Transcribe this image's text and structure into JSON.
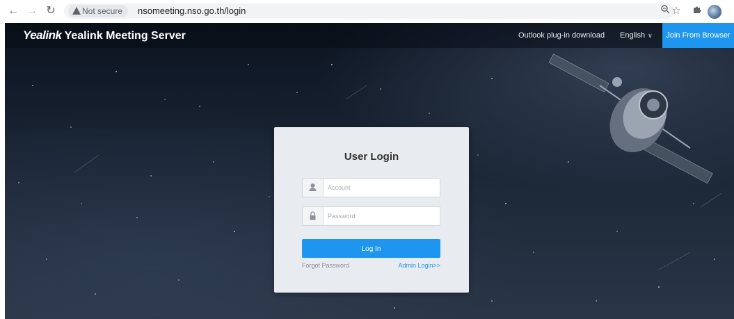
{
  "browser": {
    "security_label": "Not secure",
    "url": "nsomeeting.nso.go.th/login",
    "nav": {
      "back_icon": "back-arrow-icon",
      "forward_icon": "forward-arrow-icon",
      "reload_icon": "reload-icon"
    }
  },
  "header": {
    "logo_brand": "Yealink",
    "logo_product": "Yealink Meeting Server",
    "outlook_link": "Outlook plug-in download",
    "language": "English",
    "join_button": "Join From Browser"
  },
  "login": {
    "title": "User Login",
    "account_placeholder": "Account",
    "password_placeholder": "Password",
    "login_button": "Log In",
    "forgot_link": "Forgot Password",
    "admin_link": "Admin Login>>"
  },
  "colors": {
    "accent": "#1e96f0",
    "panel_bg": "#e8ebef",
    "night_sky": "#141d2b"
  }
}
